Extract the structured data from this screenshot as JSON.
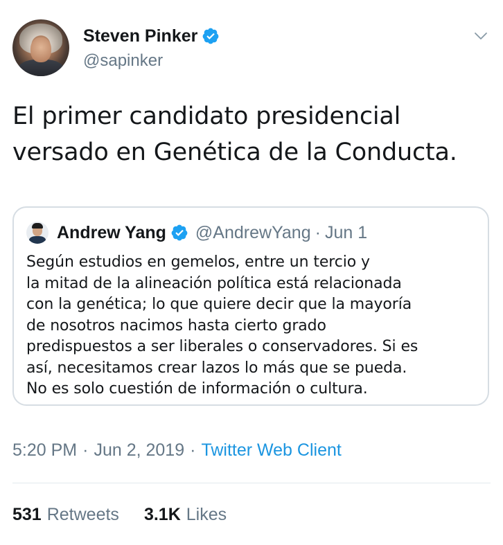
{
  "author": {
    "name": "Steven Pinker",
    "handle": "@sapinker",
    "verified_icon": "verified-badge-icon"
  },
  "tweet": {
    "lines": [
      "El primer candidato presidencial",
      "versado en Genética de la Conducta."
    ]
  },
  "quoted": {
    "name": "Andrew Yang",
    "handle": "@AndrewYang",
    "separator": "·",
    "date": "Jun 1",
    "lines": [
      "Según estudios en gemelos, entre un tercio y",
      "la mitad de la alineación política está relacionada",
      "con la genética; lo que quiere decir que la mayoría",
      "de nosotros nacimos hasta cierto grado",
      "predispuestos a ser liberales o conservadores. Si es",
      "así, necesitamos crear lazos lo más que se pueda.",
      "No es solo cuestión de información o cultura."
    ]
  },
  "meta": {
    "time": "5:20 PM",
    "dot1": "·",
    "date": "Jun 2, 2019",
    "dot2": "·",
    "client": "Twitter Web Client"
  },
  "stats": {
    "retweets_count": "531",
    "retweets_label": "Retweets",
    "likes_count": "3.1K",
    "likes_label": "Likes"
  },
  "colors": {
    "link": "#1b95e0",
    "verified": "#1da1f2",
    "secondary_text": "#657786",
    "border": "#d6dde3"
  }
}
